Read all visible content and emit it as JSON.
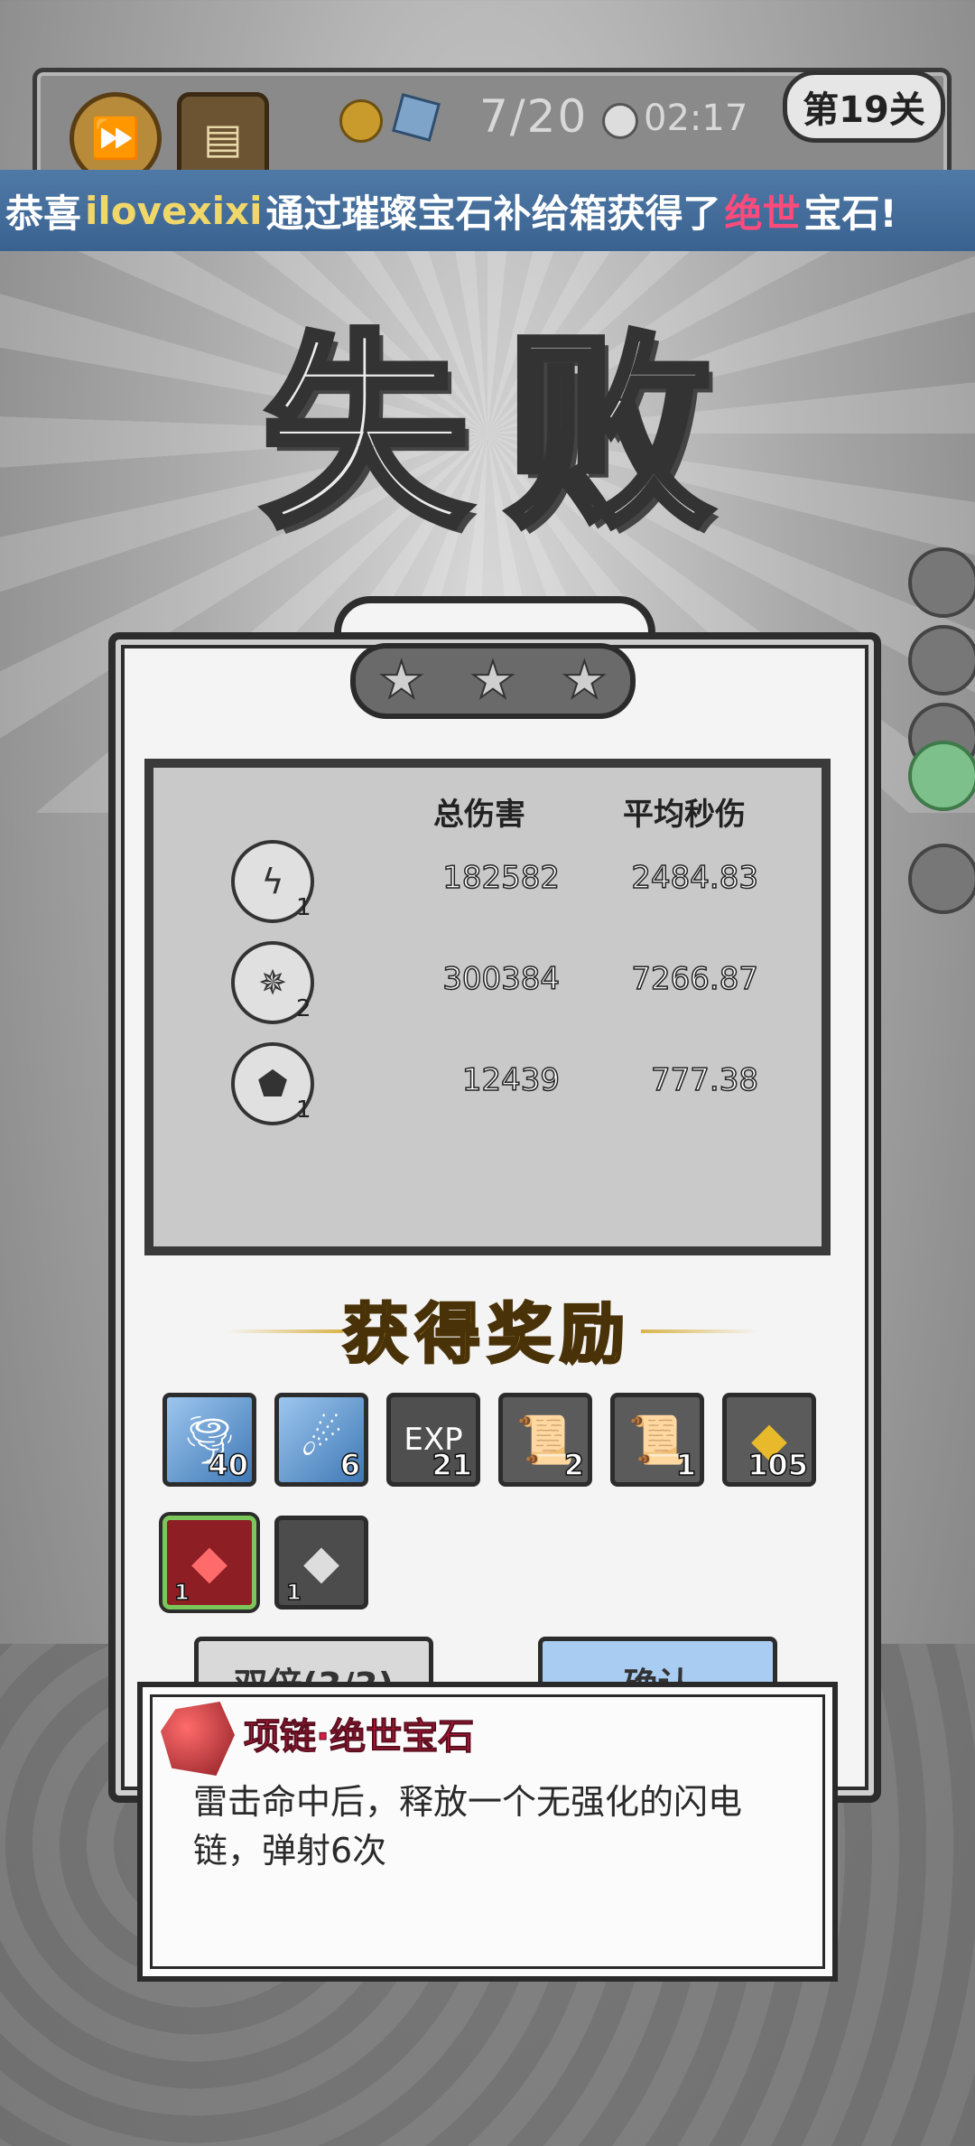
{
  "hud": {
    "wave": "7/20",
    "time": "02:17",
    "level": "第19关"
  },
  "banner": {
    "prefix": "恭喜",
    "user": "ilovexixi",
    "middle": "通过璀璨宝石补给箱获得了",
    "rarity": "绝世",
    "suffix": "宝石!"
  },
  "result": {
    "title_char_1": "失",
    "title_char_2": "败",
    "stars_earned": 0,
    "stars_total": 3
  },
  "stats": {
    "headers": {
      "total": "总伤害",
      "avg": "平均秒伤"
    },
    "rows": [
      {
        "icon": "lightning-skill-icon",
        "level": "1",
        "total": "182582",
        "avg": "2484.83"
      },
      {
        "icon": "crystal-burst-skill-icon",
        "level": "2",
        "total": "300384",
        "avg": "7266.87"
      },
      {
        "icon": "rock-skill-icon",
        "level": "1",
        "total": "12439",
        "avg": "777.38"
      }
    ]
  },
  "rewards": {
    "title": "获得奖励",
    "items": [
      {
        "name": "tornado-card",
        "count": "40",
        "color": "#3f78b5"
      },
      {
        "name": "meteor-card",
        "count": "6",
        "color": "#3f78b5"
      },
      {
        "name": "exp-orb",
        "label": "EXP",
        "count": "21"
      },
      {
        "name": "scroll-red",
        "count": "2"
      },
      {
        "name": "scroll-orange",
        "count": "1"
      },
      {
        "name": "gold-coin",
        "count": "105",
        "color": "#e8b92a"
      },
      {
        "name": "red-gem",
        "count": "1",
        "color": "#8c1e24"
      },
      {
        "name": "white-gem",
        "count": "1"
      }
    ]
  },
  "buttons": {
    "double": "双倍(3/3)",
    "confirm": "确认"
  },
  "tooltip": {
    "title": "项链·绝世宝石",
    "description": "雷击命中后，释放一个无强化的闪电链，弹射6次",
    "title_color": "#d21f45"
  }
}
